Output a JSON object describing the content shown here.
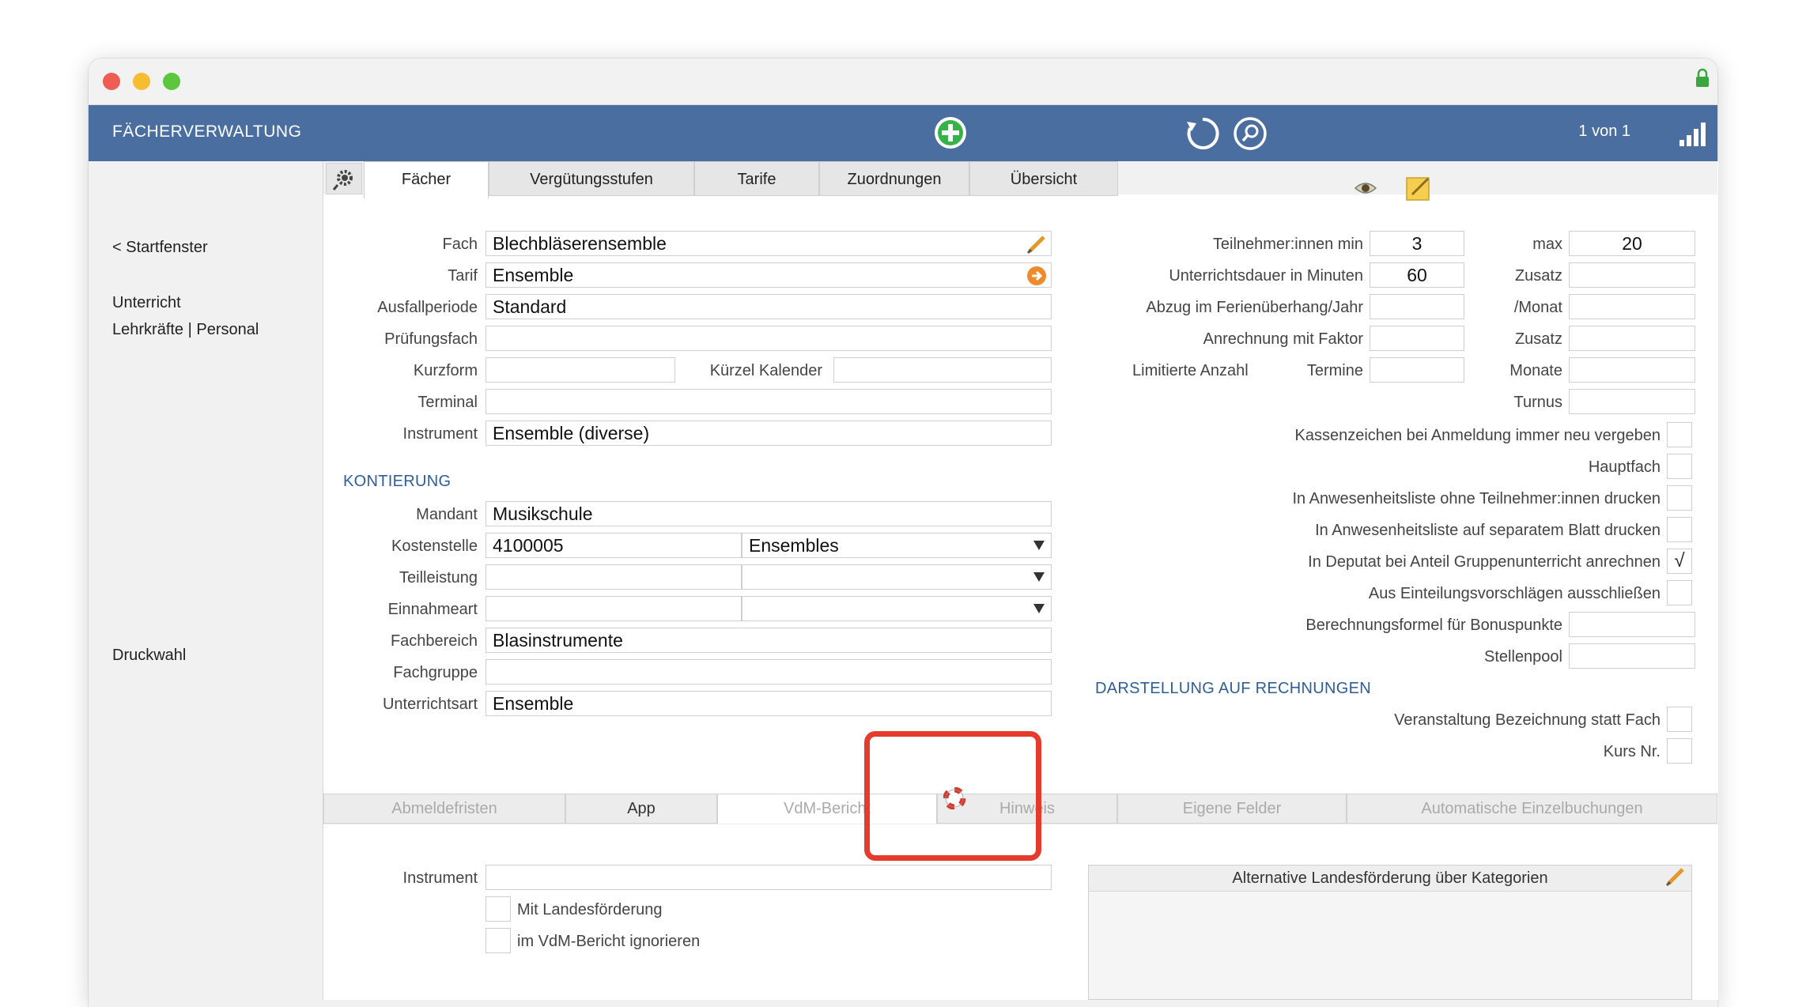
{
  "header": {
    "title": "FÄCHERVERWALTUNG",
    "record_count": "1 von 1"
  },
  "sidebar": {
    "back": "< Startfenster",
    "unterricht": "Unterricht",
    "lehrkraefte": "Lehrkräfte | Personal",
    "druckwahl": "Druckwahl"
  },
  "tabs": [
    "Fächer",
    "Vergütungsstufen",
    "Tarife",
    "Zuordnungen",
    "Übersicht"
  ],
  "left_form": {
    "fach": {
      "label": "Fach",
      "value": "Blechbläserensemble"
    },
    "tarif": {
      "label": "Tarif",
      "value": "Ensemble"
    },
    "ausfallperiode": {
      "label": "Ausfallperiode",
      "value": "Standard"
    },
    "pruefungsfach": {
      "label": "Prüfungsfach",
      "value": ""
    },
    "kurzform": {
      "label": "Kurzform",
      "value": ""
    },
    "kuerzel_kalender": {
      "label": "Kürzel Kalender",
      "value": ""
    },
    "terminal": {
      "label": "Terminal",
      "value": ""
    },
    "instrument": {
      "label": "Instrument",
      "value": "Ensemble (diverse)"
    }
  },
  "kontierung": {
    "heading": "KONTIERUNG",
    "mandant": {
      "label": "Mandant",
      "value": "Musikschule"
    },
    "kostenstelle": {
      "label": "Kostenstelle",
      "code": "4100005",
      "name": "Ensembles"
    },
    "teilleistung": {
      "label": "Teilleistung",
      "code": "",
      "name": ""
    },
    "einnahmeart": {
      "label": "Einnahmeart",
      "code": "",
      "name": ""
    },
    "fachbereich": {
      "label": "Fachbereich",
      "value": "Blasinstrumente"
    },
    "fachgruppe": {
      "label": "Fachgruppe",
      "value": ""
    },
    "unterrichtsart": {
      "label": "Unterrichtsart",
      "value": "Ensemble"
    }
  },
  "right_form": {
    "teilnehmer_min": {
      "label": "Teilnehmer:innen min",
      "value": "3"
    },
    "max": {
      "label": "max",
      "value": "20"
    },
    "dauer": {
      "label": "Unterrichtsdauer in Minuten",
      "value": "60"
    },
    "zusatz1": {
      "label": "Zusatz",
      "value": ""
    },
    "abzug": {
      "label": "Abzug im Ferienüberhang/Jahr",
      "value": ""
    },
    "monat": {
      "label": "/Monat",
      "value": ""
    },
    "anrechnung": {
      "label": "Anrechnung mit Faktor",
      "value": ""
    },
    "zusatz2": {
      "label": "Zusatz",
      "value": ""
    },
    "limitierte": {
      "label": "Limitierte Anzahl",
      "termine_label": "Termine",
      "value": ""
    },
    "monate": {
      "label": "Monate",
      "value": ""
    },
    "turnus": {
      "label": "Turnus",
      "value": ""
    }
  },
  "checkboxes": [
    {
      "label": "Kassenzeichen bei Anmeldung immer neu vergeben",
      "mark": ""
    },
    {
      "label": "Hauptfach",
      "mark": ""
    },
    {
      "label": "In Anwesenheitsliste ohne Teilnehmer:innen drucken",
      "mark": ""
    },
    {
      "label": "In Anwesenheitsliste auf separatem Blatt drucken",
      "mark": ""
    },
    {
      "label": "In Deputat bei Anteil Gruppenunterricht anrechnen",
      "mark": "√"
    },
    {
      "label": "Aus Einteilungsvorschlägen ausschließen",
      "mark": ""
    }
  ],
  "bonus": {
    "label": "Berechnungsformel für Bonuspunkte",
    "value": ""
  },
  "stellenpool": {
    "label": "Stellenpool",
    "value": ""
  },
  "darstellung": {
    "heading": "DARSTELLUNG AUF RECHNUNGEN",
    "veranstaltung": "Veranstaltung Bezeichnung statt Fach",
    "kurs_nr": "Kurs Nr."
  },
  "bottom_tabs": [
    "Abmeldefristen",
    "App",
    "VdM-Bericht",
    "Hinweis",
    "Eigene Felder",
    "Automatische Einzelbuchungen"
  ],
  "bottom_form": {
    "instrument_label": "Instrument",
    "instrument_value": "",
    "mit_landesfoerderung": "Mit Landesförderung",
    "vdm_ignorieren": "im VdM-Bericht ignorieren",
    "alt_landesfoerderung": "Alternative Landesförderung über Kategorien"
  },
  "colors": {
    "header_bg": "#4a6ea0",
    "section": "#2e5e96",
    "highlight": "#e53b2c"
  }
}
